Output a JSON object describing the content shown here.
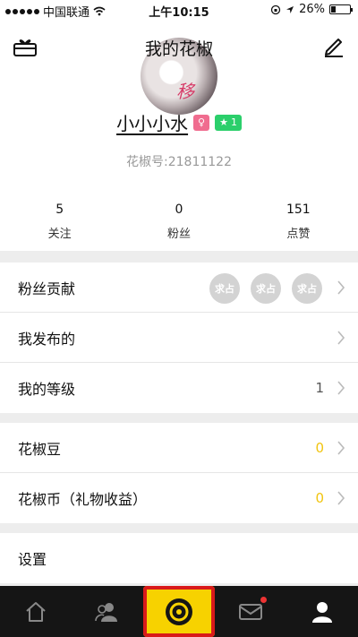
{
  "status_bar": {
    "carrier": "中国联通",
    "time": "上午10:15",
    "battery": "26%"
  },
  "header": {
    "title": "我的花椒",
    "left_icon": "gift-box-icon",
    "right_icon": "edit-pencil-icon"
  },
  "profile": {
    "nickname": "小小小水",
    "level": "1",
    "uid": "花椒号:21811122",
    "stats": [
      {
        "value": "5",
        "label": "关注"
      },
      {
        "value": "0",
        "label": "粉丝"
      },
      {
        "value": "151",
        "label": "点赞"
      }
    ]
  },
  "menu": {
    "fans_contrib": {
      "label": "粉丝贡献",
      "placeholders": [
        "求占",
        "求占",
        "求占"
      ]
    },
    "my_posts": {
      "label": "我发布的"
    },
    "my_level": {
      "label": "我的等级",
      "value": "1"
    },
    "beans": {
      "label": "花椒豆",
      "value": "0"
    },
    "coins": {
      "label": "花椒币（礼物收益）",
      "value": "0"
    },
    "settings": {
      "label": "设置"
    }
  },
  "tabbar": [
    "home-icon",
    "people-icon",
    "live-camera-icon",
    "mail-icon",
    "profile-icon"
  ],
  "colors": {
    "accent_yellow": "#f7d200",
    "highlight_red": "#d91a1a",
    "tabbar_bg": "#151515"
  }
}
